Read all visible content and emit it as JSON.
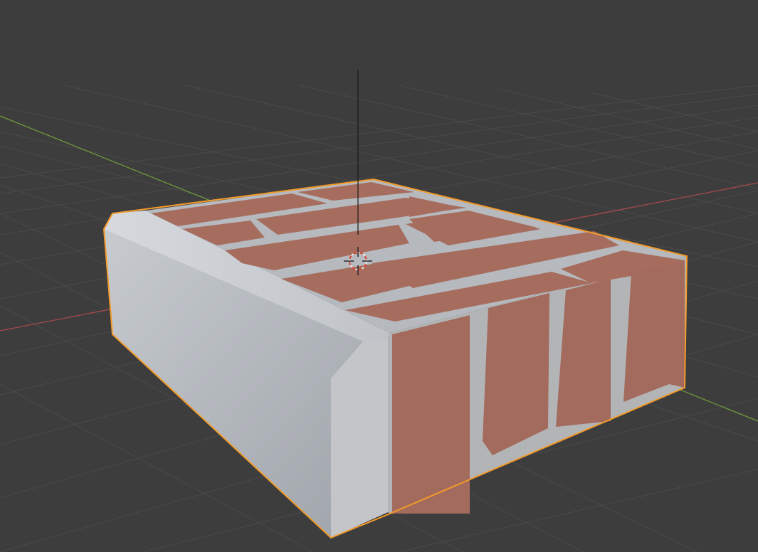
{
  "viewport": {
    "mode": "solid-textured",
    "background_color": "#3d3d3d",
    "grid_line_color": "#4b4b4b",
    "x_axis_color": "#a84a4a",
    "y_axis_color": "#6c9a3a",
    "z_axis_color": "#1a1a1a",
    "selection_outline_color": "#f39a2a"
  },
  "object": {
    "name": "brick-paver",
    "material": "brick",
    "brick_color": "#a86c5c",
    "mortar_color": "#b6b9bd",
    "trim_color": "#c9ccd2",
    "side_color": "#aeb3b9",
    "selected": true
  },
  "cursor": {
    "name": "3d-cursor",
    "ring_colors": [
      "#e8e8e8",
      "#d8443a"
    ]
  }
}
